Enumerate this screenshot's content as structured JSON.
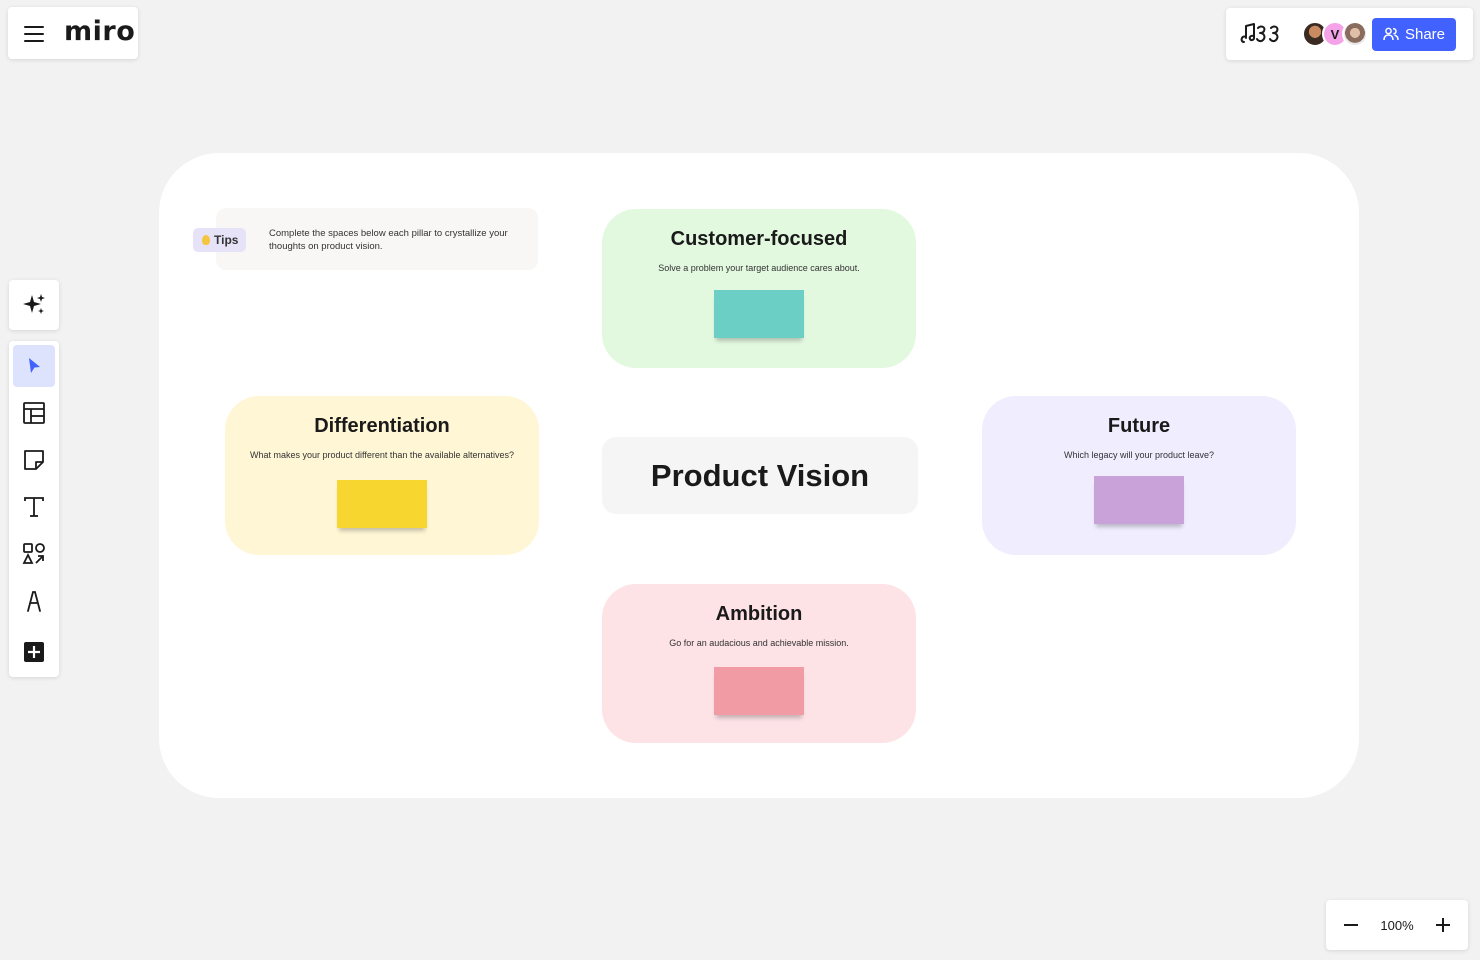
{
  "app": {
    "logo": "miro"
  },
  "header": {
    "share_label": "Share",
    "avatars": [
      {
        "initial": ""
      },
      {
        "initial": "V"
      },
      {
        "initial": ""
      }
    ]
  },
  "toolbar": {
    "tools": [
      "ai-sparkle",
      "select",
      "templates",
      "sticky-note",
      "text",
      "shapes",
      "pen",
      "more"
    ]
  },
  "zoom": {
    "value": "100%"
  },
  "board": {
    "tips": {
      "badge": "Tips",
      "text": "Complete the spaces below each pillar to crystallize your thoughts on product vision."
    },
    "center_title": "Product Vision",
    "cards": {
      "customer": {
        "title": "Customer-focused",
        "subtitle": "Solve a problem your target audience cares about.",
        "sticky_color": "#6ccfc6"
      },
      "differentiation": {
        "title": "Differentiation",
        "subtitle": "What makes your product different than the available alternatives?",
        "sticky_color": "#f7d630"
      },
      "future": {
        "title": "Future",
        "subtitle": "Which legacy will your product leave?",
        "sticky_color": "#c9a2da"
      },
      "ambition": {
        "title": "Ambition",
        "subtitle": "Go for an audacious and achievable mission.",
        "sticky_color": "#f19ba4"
      }
    }
  },
  "colors": {
    "accent": "#4262ff",
    "canvas": "#f2f2f2"
  }
}
